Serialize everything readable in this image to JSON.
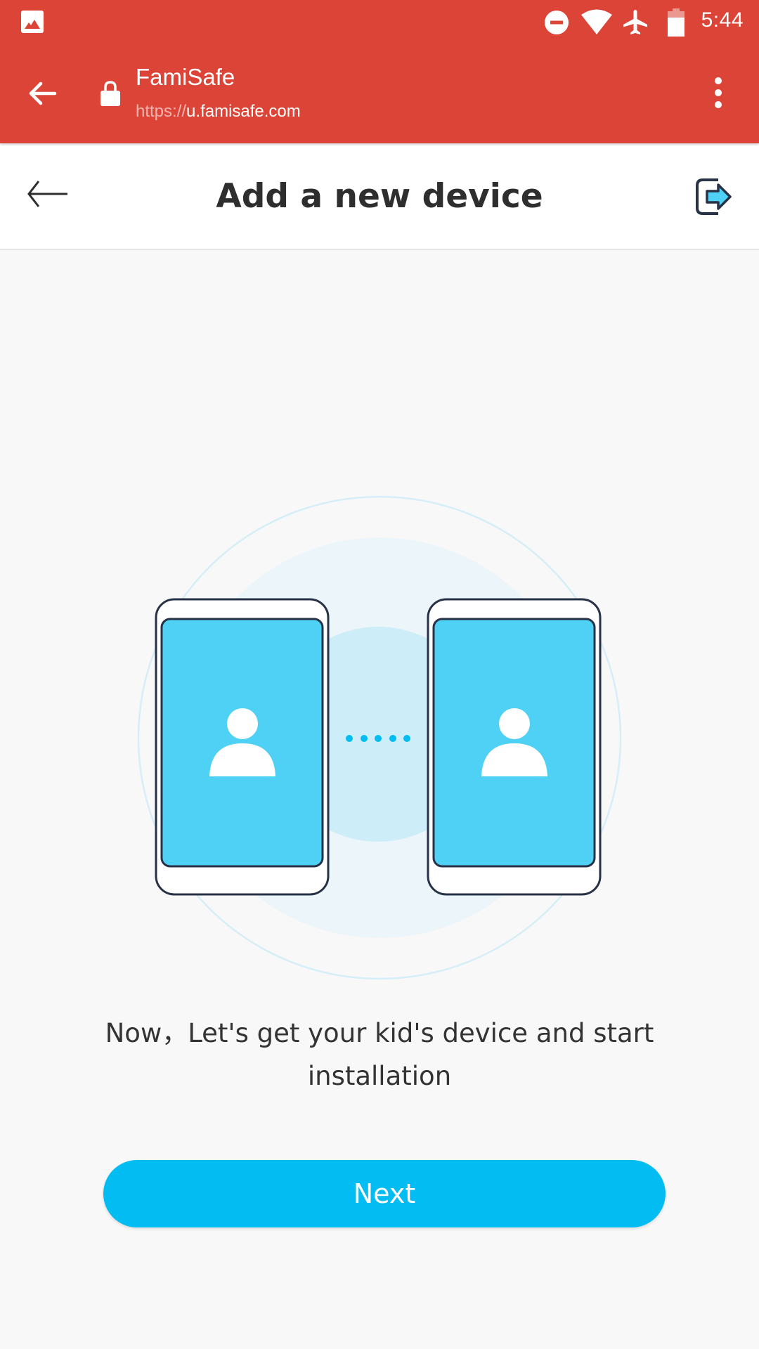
{
  "status_bar": {
    "time": "5:44",
    "icons": [
      "gallery-notification-icon",
      "do-not-disturb-icon",
      "wifi-icon",
      "airplane-mode-icon",
      "battery-icon"
    ]
  },
  "browser": {
    "title": "FamiSafe",
    "url_scheme": "https://",
    "url_host": "u.famisafe.com",
    "icons": [
      "back-arrow-icon",
      "lock-icon",
      "more-vert-icon"
    ]
  },
  "header": {
    "title": "Add a new device",
    "icons": [
      "back-arrow-icon",
      "logout-icon"
    ]
  },
  "illustration": {
    "description": "two-phones-connecting",
    "dots": 5
  },
  "main": {
    "message": "Now，Let's get your kid's device and start installation",
    "next_label": "Next"
  },
  "colors": {
    "brand_red": "#db4437",
    "accent_blue": "#03bdf2",
    "screen_blue": "#4fd0f5",
    "outline_navy": "#283247",
    "background": "#f8f8f8"
  }
}
